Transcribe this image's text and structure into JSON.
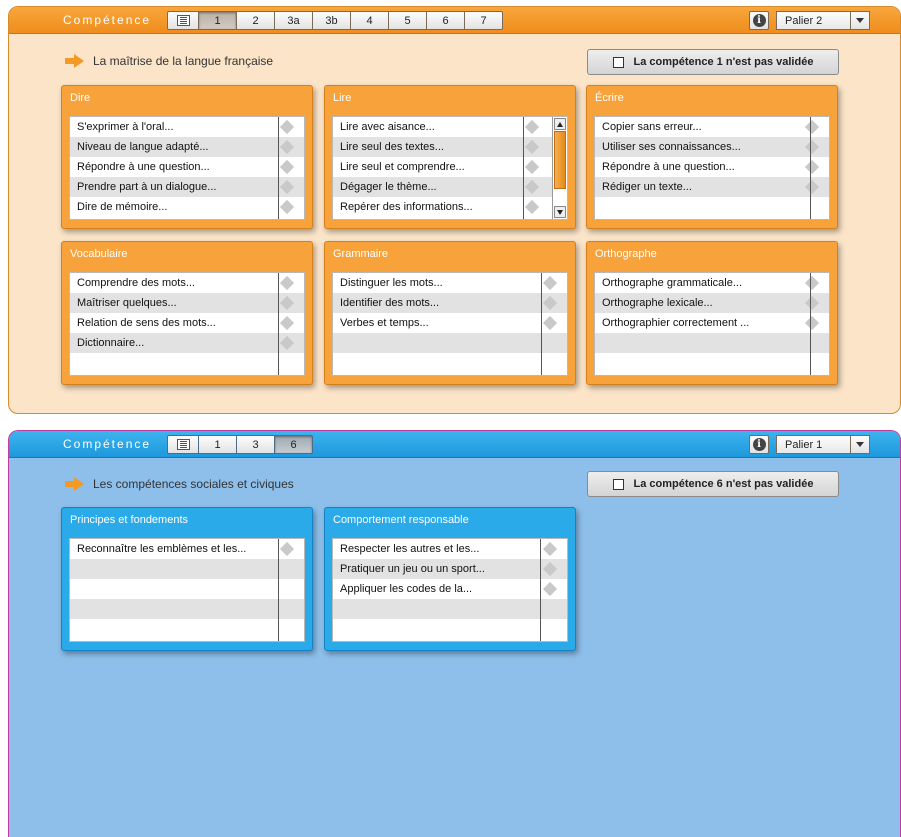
{
  "top": {
    "label": "Compétence",
    "tabs": [
      "1",
      "2",
      "3a",
      "3b",
      "4",
      "5",
      "6",
      "7"
    ],
    "active_tab": "1",
    "palier": "Palier 2",
    "section_title": "La maîtrise de la langue française",
    "validate_label": "La compétence 1 n'est pas validée",
    "cards": [
      {
        "title": "Dire",
        "items": [
          "S'exprimer à l'oral...",
          "Niveau de langue adapté...",
          "Répondre à une question...",
          "Prendre part à un dialogue...",
          "Dire de mémoire..."
        ]
      },
      {
        "title": "Lire",
        "items": [
          "Lire avec aisance...",
          "Lire seul des textes...",
          "Lire seul et comprendre...",
          "Dégager le thème...",
          "Repérer des informations..."
        ]
      },
      {
        "title": "Écrire",
        "items": [
          "Copier sans erreur...",
          "Utiliser ses connaissances...",
          "Répondre à une question...",
          "Rédiger un texte..."
        ]
      },
      {
        "title": "Vocabulaire",
        "items": [
          "Comprendre des mots...",
          "Maîtriser quelques...",
          "Relation de sens des mots...",
          "Dictionnaire..."
        ]
      },
      {
        "title": "Grammaire",
        "items": [
          "Distinguer les mots...",
          "Identifier des mots...",
          "Verbes et temps..."
        ]
      },
      {
        "title": "Orthographe",
        "items": [
          "Orthographe grammaticale...",
          "Orthographe lexicale...",
          "Orthographier correctement ..."
        ]
      }
    ]
  },
  "bottom": {
    "label": "Compétence",
    "tabs": [
      "1",
      "3",
      "6"
    ],
    "active_tab": "6",
    "palier": "Palier 1",
    "section_title": "Les compétences sociales et civiques",
    "validate_label": "La compétence 6 n'est pas validée",
    "cards": [
      {
        "title": "Principes et fondements",
        "items": [
          "Reconnaître les emblèmes et les..."
        ]
      },
      {
        "title": "Comportement responsable",
        "items": [
          "Respecter les autres et les...",
          "Pratiquer un jeu ou un sport...",
          "Appliquer les codes de la..."
        ]
      }
    ]
  },
  "icons": {
    "list": "list-view-icon",
    "info": "info-icon",
    "dropdown": "chevron-down-icon",
    "item": "status-diamond-icon",
    "section": "arrow-right-icon"
  },
  "colors": {
    "orange": "#f29a24",
    "blue": "#2aaae9",
    "panel_orange_bg": "#fbe4c8",
    "panel_blue_bg": "#8dbfea"
  }
}
